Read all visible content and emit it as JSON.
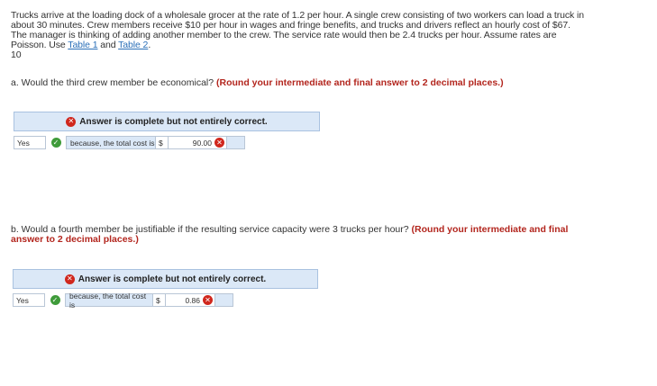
{
  "problem": {
    "text": "Trucks arrive at the loading dock of a wholesale grocer at the rate of 1.2 per hour. A single crew consisting of two workers can load a truck in about 30 minutes. Crew members receive $10 per hour in wages and fringe benefits, and trucks and drivers reflect an hourly cost of $67. The manager is thinking of adding another member to the crew. The service rate would then be 2.4 trucks per hour. Assume rates are Poisson. Use ",
    "link1": "Table 1",
    "and": " and ",
    "link2": "Table 2",
    "period": ".",
    "number": "10"
  },
  "part_a": {
    "question": "a. Would the third crew member be economical? ",
    "instruction": "(Round your intermediate and final answer to 2 decimal places.)",
    "banner": "Answer is complete but not entirely correct.",
    "select_value": "Yes",
    "because": "because, the total cost is",
    "dollar": "$",
    "answer_value": "90.00"
  },
  "part_b": {
    "question": "b. Would a fourth member be justifiable if the resulting service capacity were 3 trucks per hour? ",
    "instruction": "(Round your intermediate and final answer to 2 decimal places.)",
    "banner": "Answer is complete but not entirely correct.",
    "select_value": "Yes",
    "because": "because, the total cost is",
    "dollar": "$",
    "answer_value": "0.86"
  },
  "icons": {
    "incorrect": "x-circle-icon",
    "correct": "check-circle-icon"
  },
  "colors": {
    "instruction": "#b3261e",
    "link": "#2a6fb8",
    "banner_bg": "#dbe8f7",
    "incorrect": "#d0271d",
    "correct": "#3f9b3a"
  }
}
